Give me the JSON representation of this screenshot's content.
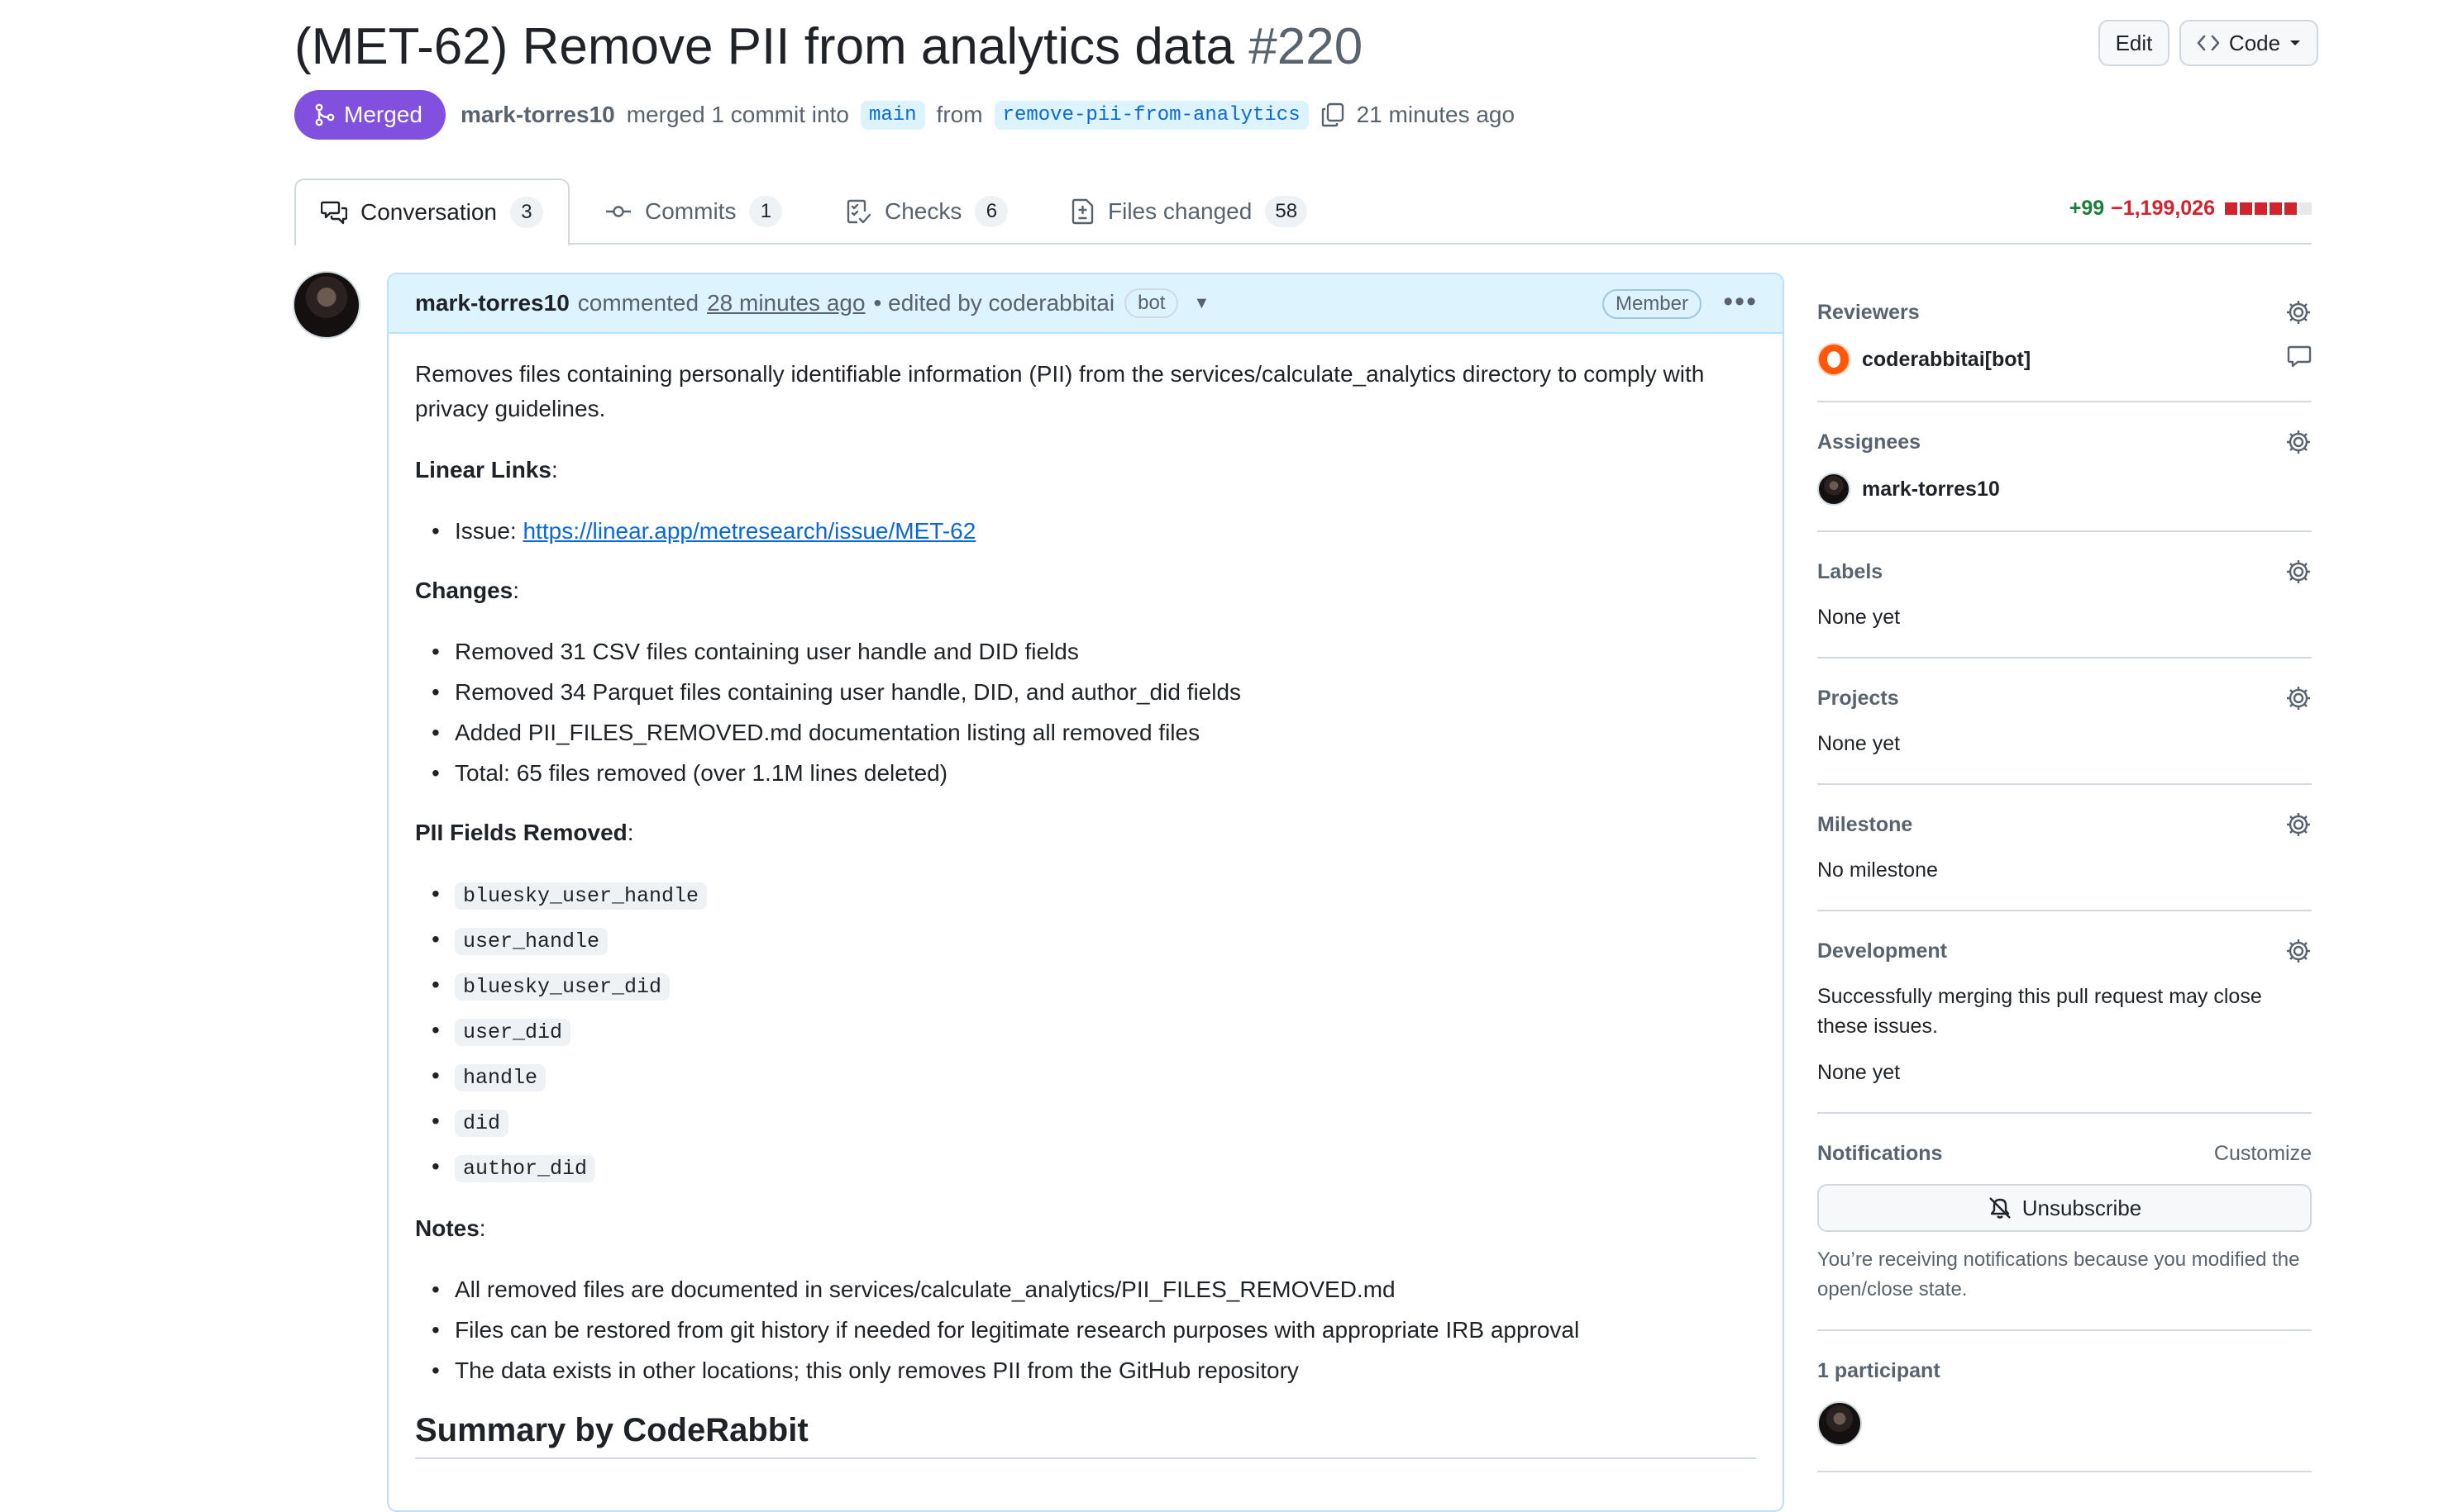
{
  "pr": {
    "title": "(MET-62) Remove PII from analytics data",
    "number": "#220",
    "edit_label": "Edit",
    "code_label": "Code",
    "status": "Merged",
    "author": "mark-torres10",
    "merge_text": "merged 1 commit into",
    "base_branch": "main",
    "from_text": "from",
    "head_branch": "remove-pii-from-analytics",
    "time": "21 minutes ago"
  },
  "tabs": [
    {
      "label": "Conversation",
      "count": "3"
    },
    {
      "label": "Commits",
      "count": "1"
    },
    {
      "label": "Checks",
      "count": "6"
    },
    {
      "label": "Files changed",
      "count": "58"
    }
  ],
  "diffstat": {
    "additions": "+99",
    "deletions": "−1,199,026",
    "colors": [
      "#d1242f",
      "#d1242f",
      "#d1242f",
      "#d1242f",
      "#d1242f",
      "#e6e8eb"
    ]
  },
  "comment": {
    "author": "mark-torres10",
    "verb": "commented",
    "time": "28 minutes ago",
    "edited": "• edited by coderabbitai",
    "bot_badge": "bot",
    "member_badge": "Member",
    "intro": "Removes files containing personally identifiable information (PII) from the services/calculate_analytics directory to comply with privacy guidelines.",
    "linear_heading": "Linear Links",
    "issue_prefix": "Issue: ",
    "issue_link": "https://linear.app/metresearch/issue/MET-62",
    "changes_heading": "Changes",
    "changes": [
      "Removed 31 CSV files containing user handle and DID fields",
      "Removed 34 Parquet files containing user handle, DID, and author_did fields",
      "Added PII_FILES_REMOVED.md documentation listing all removed files",
      "Total: 65 files removed (over 1.1M lines deleted)"
    ],
    "fields_heading": "PII Fields Removed",
    "fields": [
      "bluesky_user_handle",
      "user_handle",
      "bluesky_user_did",
      "user_did",
      "handle",
      "did",
      "author_did"
    ],
    "notes_heading": "Notes",
    "notes": [
      "All removed files are documented in services/calculate_analytics/PII_FILES_REMOVED.md",
      "Files can be restored from git history if needed for legitimate research purposes with appropriate IRB approval",
      "The data exists in other locations; this only removes PII from the GitHub repository"
    ],
    "summary_heading": "Summary by CodeRabbit"
  },
  "sidebar": {
    "reviewers_title": "Reviewers",
    "reviewer": "coderabbitai[bot]",
    "assignees_title": "Assignees",
    "assignee": "mark-torres10",
    "labels_title": "Labels",
    "labels_value": "None yet",
    "projects_title": "Projects",
    "projects_value": "None yet",
    "milestone_title": "Milestone",
    "milestone_value": "No milestone",
    "development_title": "Development",
    "development_text": "Successfully merging this pull request may close these issues.",
    "development_value": "None yet",
    "notifications_title": "Notifications",
    "customize_label": "Customize",
    "unsubscribe_label": "Unsubscribe",
    "notifications_text": "You’re receiving notifications because you modified the open/close state.",
    "participants_title": "1 participant"
  }
}
